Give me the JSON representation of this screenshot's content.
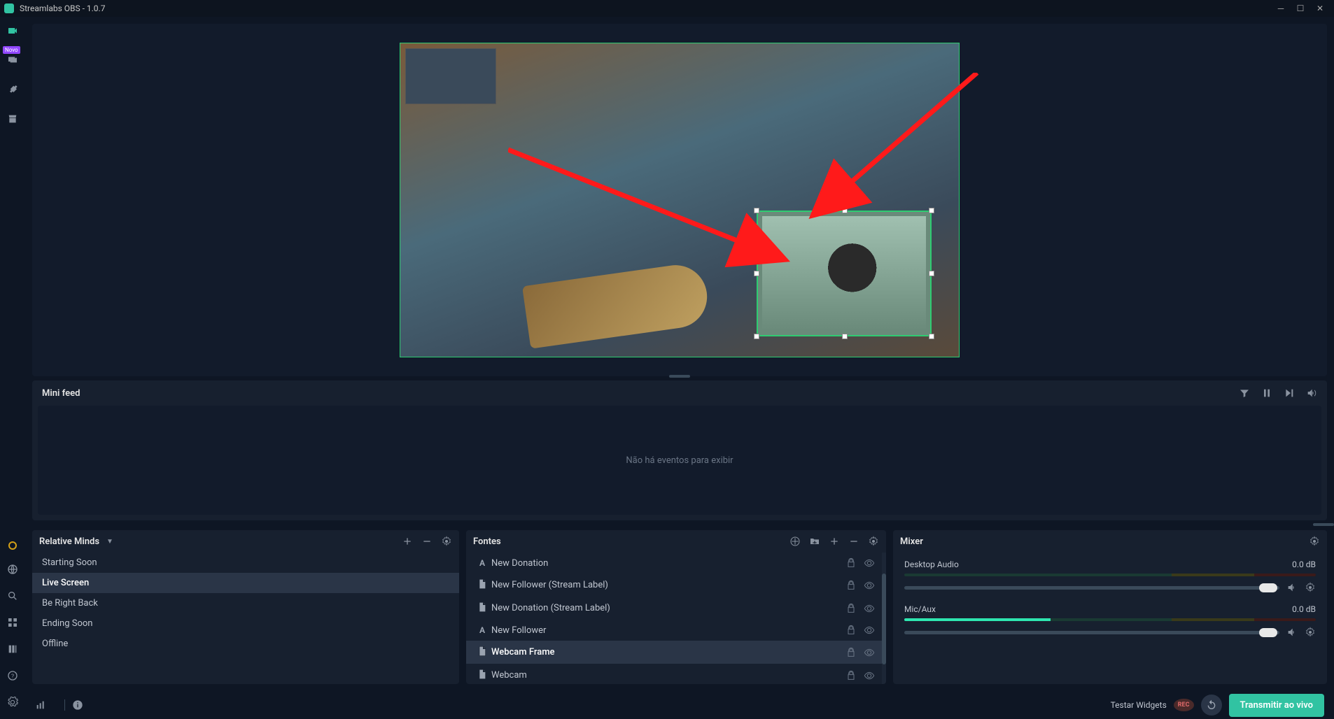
{
  "titlebar": {
    "title": "Streamlabs OBS - 1.0.7"
  },
  "sidebar": {
    "badge": "Novo"
  },
  "minifeed": {
    "title": "Mini feed",
    "empty": "Não há eventos para exibir"
  },
  "scenes": {
    "title": "Relative Minds",
    "items": [
      {
        "label": "Starting Soon",
        "selected": false
      },
      {
        "label": "Live Screen",
        "selected": true
      },
      {
        "label": "Be Right Back",
        "selected": false
      },
      {
        "label": "Ending Soon",
        "selected": false
      },
      {
        "label": "Offline",
        "selected": false
      }
    ]
  },
  "sources": {
    "title": "Fontes",
    "items": [
      {
        "icon": "A",
        "label": "New Donation",
        "selected": false
      },
      {
        "icon": "file",
        "label": "New Follower (Stream Label)",
        "selected": false
      },
      {
        "icon": "file",
        "label": "New Donation (Stream Label)",
        "selected": false
      },
      {
        "icon": "A",
        "label": "New Follower",
        "selected": false
      },
      {
        "icon": "file",
        "label": "Webcam Frame",
        "selected": true
      },
      {
        "icon": "file",
        "label": "Webcam",
        "selected": false
      }
    ]
  },
  "mixer": {
    "title": "Mixer",
    "channels": [
      {
        "name": "Desktop Audio",
        "db": "0.0 dB",
        "level": 0,
        "thumb": 97
      },
      {
        "name": "Mic/Aux",
        "db": "0.0 dB",
        "level": 35,
        "thumb": 97
      }
    ]
  },
  "statusbar": {
    "test_widgets": "Testar Widgets",
    "rec": "REC",
    "go_live": "Transmitir ao vivo"
  }
}
